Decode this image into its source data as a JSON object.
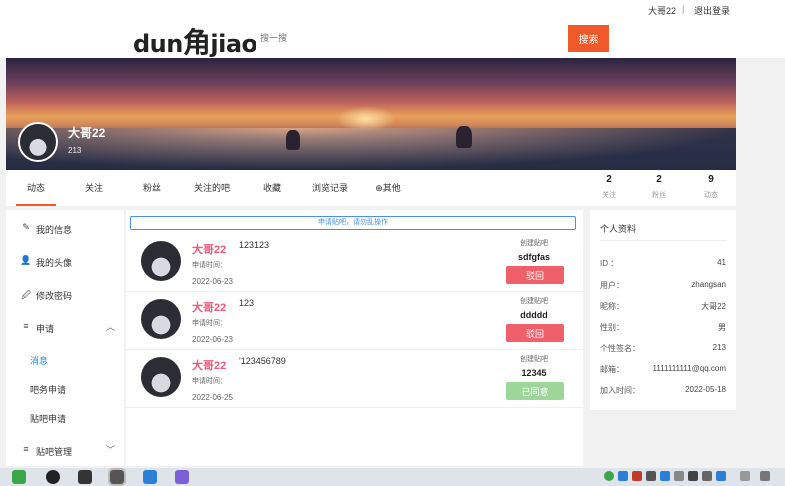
{
  "topbar": {
    "username": "大哥22",
    "separator": "|",
    "logout": "退出登录"
  },
  "header": {
    "logo_left": "dun",
    "logo_mid": "角",
    "logo_right": "jiao",
    "search_placeholder": "搜一搜",
    "search_button": "搜索"
  },
  "profile": {
    "name": "大哥22",
    "id": "213"
  },
  "tabs": [
    "动态",
    "关注",
    "粉丝",
    "关注的吧",
    "收藏",
    "浏览记录",
    "⊕其他"
  ],
  "stats": [
    {
      "num": "2",
      "label": "关注"
    },
    {
      "num": "2",
      "label": "粉丝"
    },
    {
      "num": "9",
      "label": "动态"
    }
  ],
  "sidebar": {
    "items": [
      {
        "icon": "✎",
        "label": "我的信息"
      },
      {
        "icon": "👤",
        "label": "我的头像"
      },
      {
        "icon": "🖉",
        "label": "修改密码"
      },
      {
        "icon": "≡",
        "label": "申请"
      }
    ],
    "sub": [
      "消息",
      "吧务申请",
      "贴吧申请"
    ],
    "bottom": {
      "icon": "≡",
      "label": "贴吧管理"
    },
    "chevron_up": "︿",
    "chevron_down": "﹀"
  },
  "notice": "申请贴吧，请勿乱操作",
  "rows": [
    {
      "name": "大哥22",
      "content": "123123",
      "time_label": "申请时间：",
      "time": "2022-06-23",
      "bar_label": "创建贴吧",
      "bar_name": "sdfgfas",
      "button": "驳回",
      "button_color": "red"
    },
    {
      "name": "大哥22",
      "content": "123",
      "time_label": "申请时间：",
      "time": "2022-06-23",
      "bar_label": "创建贴吧",
      "bar_name": "ddddd",
      "button": "驳回",
      "button_color": "red"
    },
    {
      "name": "大哥22",
      "content": "'123456789",
      "time_label": "申请时间：",
      "time": "2022-06-25",
      "bar_label": "创建贴吧",
      "bar_name": "12345",
      "button": "已同意",
      "button_color": "green"
    }
  ],
  "info": {
    "title": "个人资料",
    "fields": [
      {
        "k": "ID ：",
        "v": "41"
      },
      {
        "k": "用户：",
        "v": "zhangsan"
      },
      {
        "k": "昵称：",
        "v": "大哥22"
      },
      {
        "k": "性别：",
        "v": "男"
      },
      {
        "k": "个性签名：",
        "v": "213"
      },
      {
        "k": "邮箱：",
        "v": "1111111111@qq.com"
      },
      {
        "k": "加入时间：",
        "v": "2022-05-18"
      }
    ]
  },
  "colors": {
    "accent": "#f05a2a",
    "reject": "#f0606a",
    "approved": "#9ed69a",
    "name": "#f05a7a",
    "link": "#4a90e2"
  }
}
